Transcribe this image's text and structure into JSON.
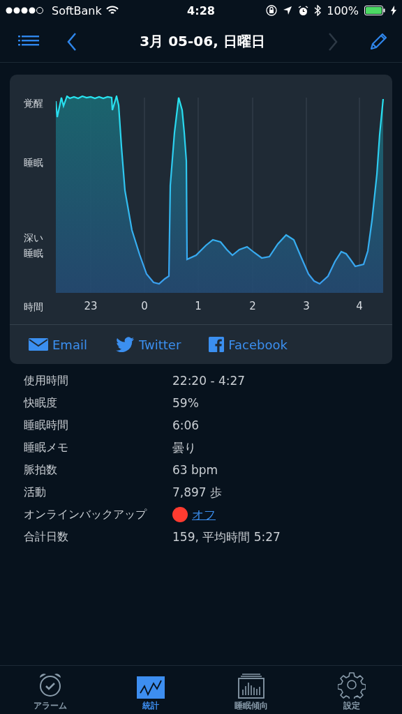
{
  "status_bar": {
    "carrier": "SoftBank",
    "time": "4:28",
    "battery": "100%"
  },
  "nav": {
    "title": "3月 05-06, 日曜日",
    "next_disabled": true
  },
  "sleep_graph": {
    "y_labels": [
      "覚醒",
      "睡眠",
      "深い睡眠"
    ],
    "x_title": "時間",
    "x_labels": [
      "23",
      "0",
      "1",
      "2",
      "3",
      "4"
    ]
  },
  "share": [
    {
      "kind": "email",
      "label": "Email"
    },
    {
      "kind": "twitter",
      "label": "Twitter"
    },
    {
      "kind": "facebook",
      "label": "Facebook"
    }
  ],
  "stats": [
    {
      "kind": "text",
      "label": "使用時間",
      "value": "22:20 - 4:27"
    },
    {
      "kind": "text",
      "label": "快眠度",
      "value": "59%"
    },
    {
      "kind": "text",
      "label": "睡眠時間",
      "value": "6:06"
    },
    {
      "kind": "text",
      "label": "睡眠メモ",
      "value": "曇り"
    },
    {
      "kind": "text",
      "label": "脈拍数",
      "value": "63 bpm"
    },
    {
      "kind": "text",
      "label": "活動",
      "value": "7,897 歩"
    },
    {
      "kind": "status",
      "label": "オンラインバックアップ",
      "value": "オフ",
      "color": "#ff3b30"
    },
    {
      "kind": "text",
      "label": "合計日数",
      "value": "159, 平均時間 5:27"
    }
  ],
  "tabs": [
    {
      "kind": "alarm",
      "label": "アラーム",
      "selected": false
    },
    {
      "kind": "stats",
      "label": "統計",
      "selected": true
    },
    {
      "kind": "trend",
      "label": "睡眠傾向",
      "selected": false
    },
    {
      "kind": "settings",
      "label": "設定",
      "selected": false
    }
  ]
}
